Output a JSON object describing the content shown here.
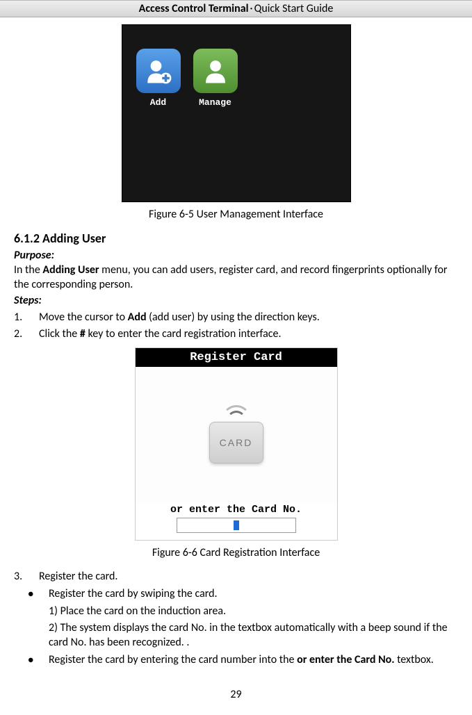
{
  "header": {
    "bold_part": "Access Control Terminal",
    "separator": "·",
    "light_part": "Quick Start Guide"
  },
  "figure1": {
    "tiles": {
      "add": "Add",
      "manage": "Manage"
    },
    "caption": "Figure 6-5 User Management Interface"
  },
  "section": {
    "heading": "6.1.2 Adding User",
    "purpose_label": "Purpose:",
    "purpose_text_pre": "In the ",
    "purpose_bold": "Adding User",
    "purpose_text_post": " menu, you can add users, register card, and record fingerprints optionally for the corresponding person.",
    "steps_label": "Steps:"
  },
  "steps": {
    "s1_pre": "Move the cursor to ",
    "s1_bold": "Add",
    "s1_post": " (add user) by using the direction keys.",
    "s2_pre": "Click the ",
    "s2_bold": "#",
    "s2_post": " key to enter the card registration interface.",
    "s3": "Register the card."
  },
  "figure2": {
    "title": "Register Card",
    "card_text": "CARD",
    "prompt": "or enter the Card No.",
    "caption": "Figure 6-6 Card Registration Interface"
  },
  "bullets": {
    "b1": "Register the card by swiping the card.",
    "b1_sub1": "1)   Place the card on the induction area.",
    "b1_sub2": "2)   The system displays the card No. in the textbox automatically with a beep sound if the card No. has been recognized. .",
    "b2_pre": "Register the card by entering the card number into the ",
    "b2_bold": "or enter the Card No.",
    "b2_post": " textbox."
  },
  "page_number": "29"
}
